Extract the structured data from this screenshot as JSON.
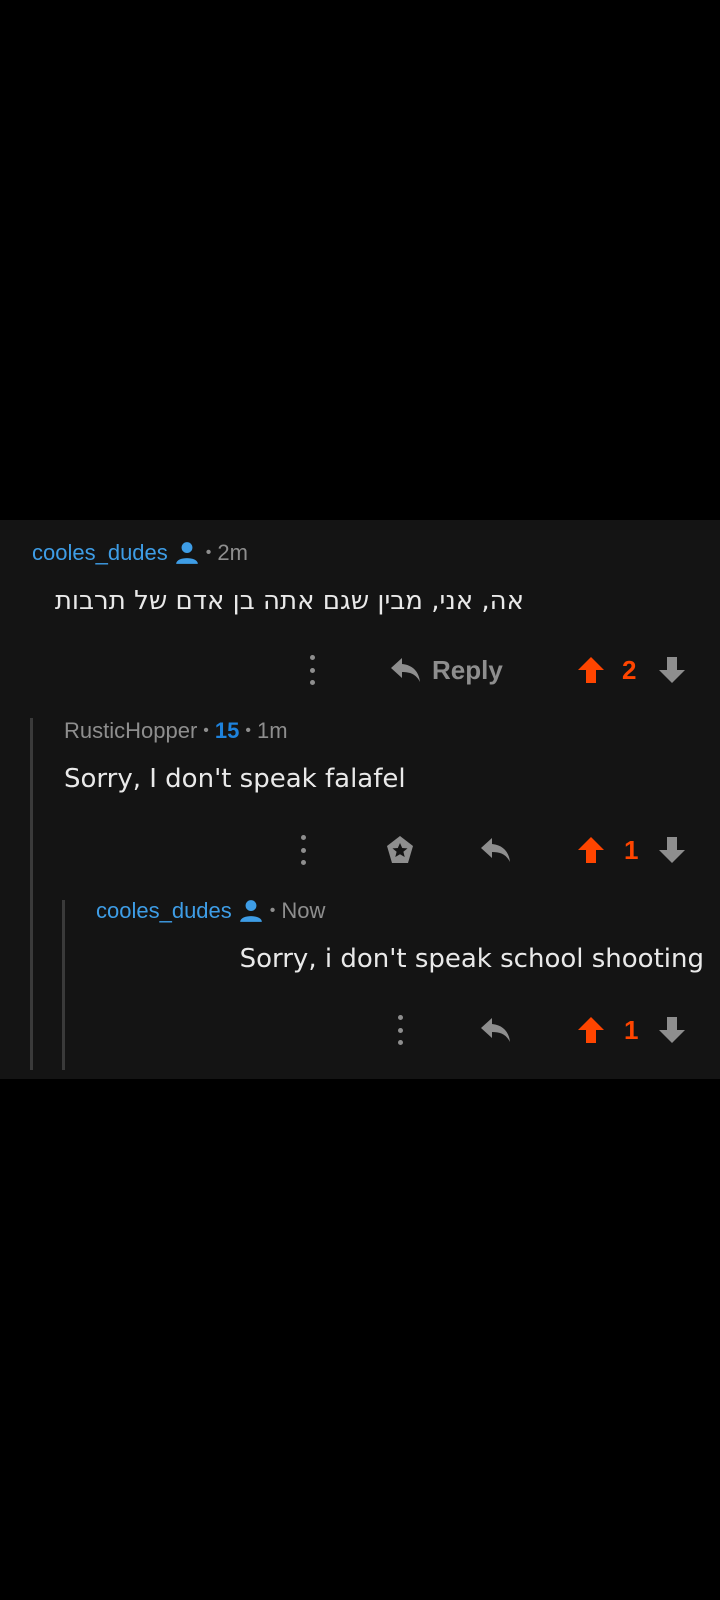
{
  "comments": [
    {
      "author": "cooles_dudes",
      "time": "2m",
      "body": "אה, אני, מבין שגם אתה בן אדם של תרבות",
      "reply_label": "Reply",
      "score": "2"
    },
    {
      "author": "RusticHopper",
      "karma": "15",
      "time": "1m",
      "body": "Sorry, I don't speak falafel",
      "score": "1"
    },
    {
      "author": "cooles_dudes",
      "time": "Now",
      "body": "Sorry, i don't speak school shooting",
      "score": "1"
    }
  ],
  "colors": {
    "background": "#000000",
    "card": "#141414",
    "op_author": "#3e9de6",
    "karma": "#1e82dc",
    "upvote": "#ff4500",
    "muted": "#8e8e8e"
  },
  "icons": [
    "op-user-icon",
    "more-options-icon",
    "reply-arrow-icon",
    "award-icon",
    "upvote-arrow-icon",
    "downvote-arrow-icon"
  ]
}
